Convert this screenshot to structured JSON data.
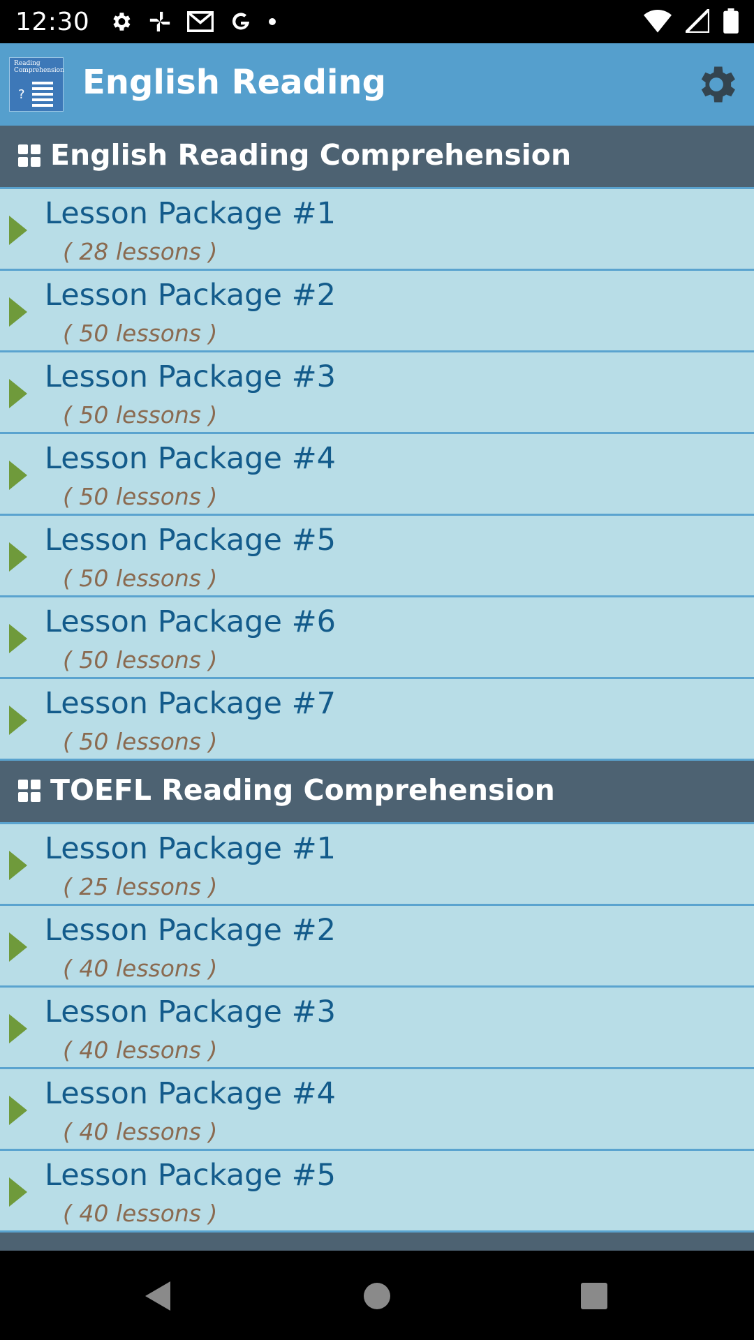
{
  "status_bar": {
    "time": "12:30",
    "left_icons": [
      "gear-icon",
      "pinwheel-icon",
      "gmail-icon",
      "google-icon",
      "dot-icon"
    ],
    "right_icons": [
      "wifi-icon",
      "signal-icon",
      "battery-icon"
    ]
  },
  "app_bar": {
    "logo_text": "Reading Comprehension",
    "title": "English Reading",
    "settings_icon": "gear-icon",
    "color": "#559fcd"
  },
  "sections": [
    {
      "title": "English Reading Comprehension",
      "items": [
        {
          "label": "Lesson Package #1",
          "count": "( 28 lessons )"
        },
        {
          "label": "Lesson Package #2",
          "count": "( 50 lessons )"
        },
        {
          "label": "Lesson Package #3",
          "count": "( 50 lessons )"
        },
        {
          "label": "Lesson Package #4",
          "count": "( 50 lessons )"
        },
        {
          "label": "Lesson Package #5",
          "count": "( 50 lessons )"
        },
        {
          "label": "Lesson Package #6",
          "count": "( 50 lessons )"
        },
        {
          "label": "Lesson Package #7",
          "count": "( 50 lessons )"
        }
      ]
    },
    {
      "title": "TOEFL Reading Comprehension",
      "items": [
        {
          "label": "Lesson Package #1",
          "count": "( 25 lessons )"
        },
        {
          "label": "Lesson Package #2",
          "count": "( 40 lessons )"
        },
        {
          "label": "Lesson Package #3",
          "count": "( 40 lessons )"
        },
        {
          "label": "Lesson Package #4",
          "count": "( 40 lessons )"
        },
        {
          "label": "Lesson Package #5",
          "count": "( 40 lessons )"
        }
      ]
    }
  ],
  "nav_bar": {
    "buttons": [
      "back-icon",
      "home-icon",
      "recents-icon"
    ]
  },
  "colors": {
    "section_header": "#4d6272",
    "row_background": "#b8dde7",
    "row_divider": "#5aa3cf",
    "item_label": "#135b8b",
    "item_count": "#8a6a50",
    "arrow": "#6f9a3b"
  }
}
